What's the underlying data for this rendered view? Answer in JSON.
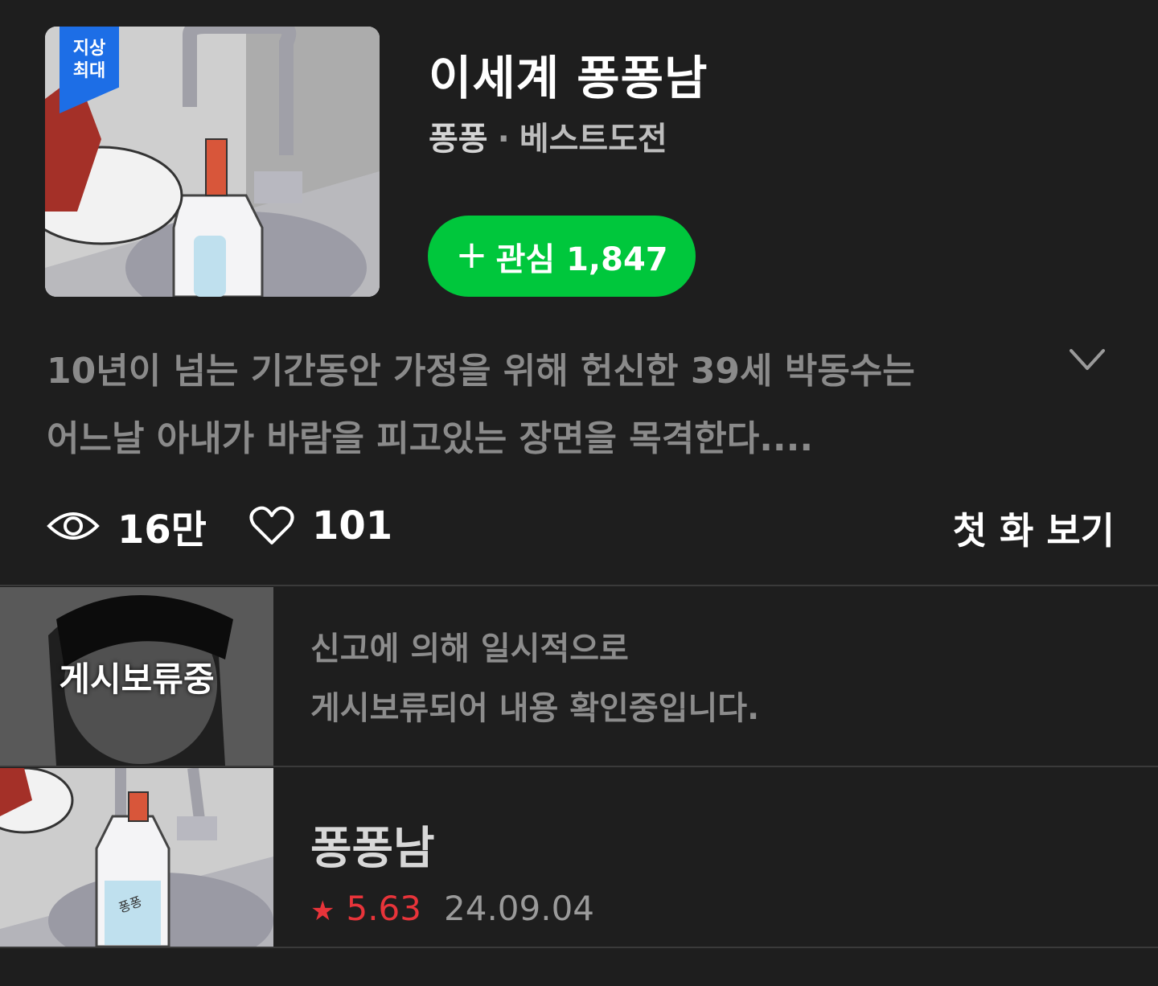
{
  "header": {
    "badge_line1": "지상",
    "badge_line2": "최대",
    "title": "이세계 퐁퐁남",
    "author": "퐁퐁",
    "separator": "·",
    "genre": "베스트도전",
    "follow_label": "관심 1,847",
    "follow_plus": "+"
  },
  "description": {
    "line1": "10년이 넘는 기간동안 가정을 위해 헌신한 39세 박동수는",
    "line2": "어느날 아내가 바람을 피고있는 장면을 목격한다...."
  },
  "stats": {
    "views": "16만",
    "likes": "101",
    "first_episode": "첫 화 보기"
  },
  "episodes": [
    {
      "thumb_label": "게시보류중",
      "notice_line1": "신고에 의해 일시적으로",
      "notice_line2": "게시보류되어 내용 확인중입니다."
    },
    {
      "title": "퐁퐁남",
      "star": "★",
      "rating": "5.63",
      "date": "24.09.04",
      "bottle_text": "퐁퐁"
    }
  ],
  "colors": {
    "background": "#1e1e1e",
    "follow_green": "#00c73c",
    "badge_blue": "#1d6ee6",
    "rating_red": "#e8343a"
  },
  "icons": [
    "eye-icon",
    "heart-icon",
    "chevron-down-icon",
    "plus-icon",
    "star-icon"
  ]
}
